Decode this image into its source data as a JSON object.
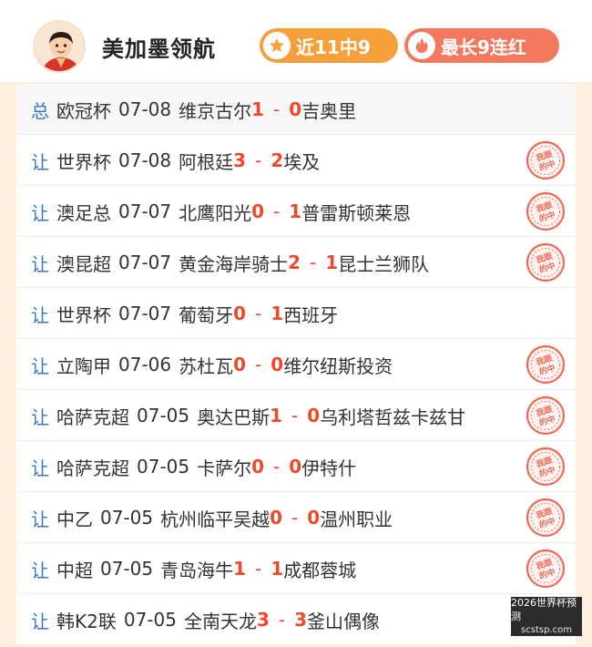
{
  "header": {
    "expert_name": "美加墨领航",
    "avatar_icon": "person-avatar",
    "badge_recent": {
      "label": "近11中9",
      "icon": "star-icon",
      "color": "#f5a03b"
    },
    "badge_streak": {
      "label": "最长9连红",
      "icon": "flame-icon",
      "color": "#f2785f"
    }
  },
  "rows": [
    {
      "type": "总",
      "league": "欧冠杯",
      "date": "07-08",
      "home": "维京古尔",
      "home_score": "1",
      "away_score": "0",
      "away": "吉奥里",
      "stamp": false
    },
    {
      "type": "让",
      "league": "世界杯",
      "date": "07-08",
      "home": "阿根廷",
      "home_score": "3",
      "away_score": "2",
      "away": "埃及",
      "stamp": true
    },
    {
      "type": "让",
      "league": "澳足总",
      "date": "07-07",
      "home": "北鹰阳光",
      "home_score": "0",
      "away_score": "1",
      "away": "普雷斯顿莱恩",
      "stamp": true
    },
    {
      "type": "让",
      "league": "澳昆超",
      "date": "07-07",
      "home": "黄金海岸骑士",
      "home_score": "2",
      "away_score": "1",
      "away": "昆士兰狮队",
      "stamp": true
    },
    {
      "type": "让",
      "league": "世界杯",
      "date": "07-07",
      "home": "葡萄牙",
      "home_score": "0",
      "away_score": "1",
      "away": "西班牙",
      "stamp": false
    },
    {
      "type": "让",
      "league": "立陶甲",
      "date": "07-06",
      "home": "苏杜瓦",
      "home_score": "0",
      "away_score": "0",
      "away": "维尔纽斯投资",
      "stamp": true
    },
    {
      "type": "让",
      "league": "哈萨克超",
      "date": "07-05",
      "home": "奥达巴斯",
      "home_score": "1",
      "away_score": "0",
      "away": "乌利塔哲兹卡兹甘",
      "stamp": true
    },
    {
      "type": "让",
      "league": "哈萨克超",
      "date": "07-05",
      "home": "卡萨尔",
      "home_score": "0",
      "away_score": "0",
      "away": "伊特什",
      "stamp": true
    },
    {
      "type": "让",
      "league": "中乙",
      "date": "07-05",
      "home": "杭州临平吴越",
      "home_score": "0",
      "away_score": "0",
      "away": "温州职业",
      "stamp": true
    },
    {
      "type": "让",
      "league": "中超",
      "date": "07-05",
      "home": "青岛海牛",
      "home_score": "1",
      "away_score": "1",
      "away": "成都蓉城",
      "stamp": true
    },
    {
      "type": "让",
      "league": "韩K2联",
      "date": "07-05",
      "home": "全南天龙",
      "home_score": "3",
      "away_score": "3",
      "away": "釜山偶像",
      "stamp": false
    }
  ],
  "stamp_text": "我跟的中",
  "watermark": {
    "line1": "2026世界杯预测",
    "line2": "scstsp.com"
  },
  "colors": {
    "accent_red": "#ee4a2a",
    "type_blue": "#3b78c8",
    "page_bg": "#fdeedd"
  }
}
